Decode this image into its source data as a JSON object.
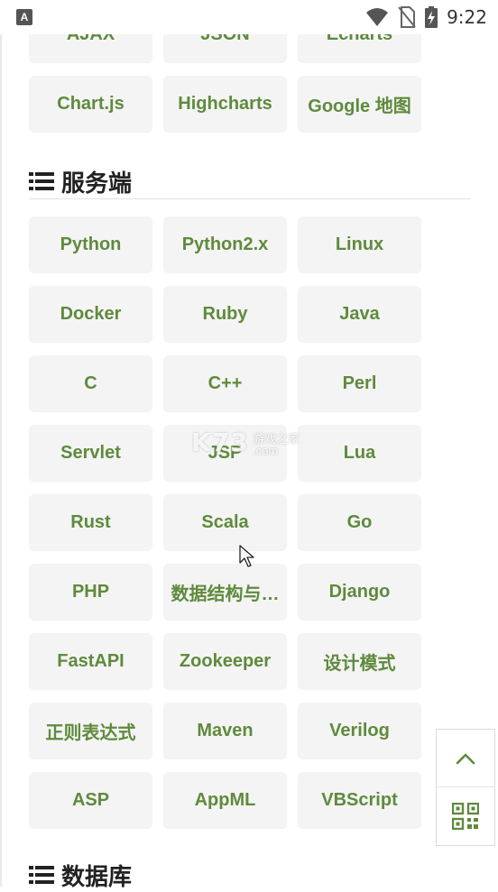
{
  "status_bar": {
    "app_icon_letter": "A",
    "time": "9:22"
  },
  "top_partial_row": [
    "AJAX",
    "JSON",
    "Echarts"
  ],
  "frontend_row": [
    "Chart.js",
    "Highcharts",
    "Google 地图"
  ],
  "sections": {
    "server": {
      "title": "服务端",
      "items": [
        "Python",
        "Python2.x",
        "Linux",
        "Docker",
        "Ruby",
        "Java",
        "C",
        "C++",
        "Perl",
        "Servlet",
        "JSP",
        "Lua",
        "Rust",
        "Scala",
        "Go",
        "PHP",
        "数据结构与…",
        "Django",
        "FastAPI",
        "Zookeeper",
        "设计模式",
        "正则表达式",
        "Maven",
        "Verilog",
        "ASP",
        "AppML",
        "VBScript"
      ]
    },
    "database": {
      "title": "数据库"
    }
  },
  "watermark": {
    "main": "K73",
    "sub1": "游戏之家",
    "sub2": ".com"
  },
  "float_panel": {
    "back_to_top_icon": "chevron-up-icon",
    "qr_icon": "qr-code-icon"
  },
  "colors": {
    "accent_green": "#5f8a3c",
    "button_bg": "#f4f4f4"
  }
}
